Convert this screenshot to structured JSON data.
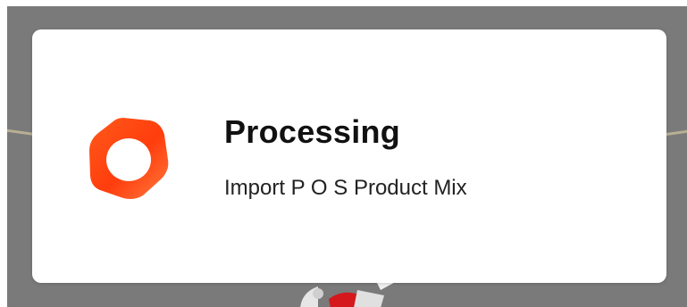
{
  "dialog": {
    "title": "Processing",
    "message": "Import P O S Product Mix",
    "spinner_icon": "loading-ring-icon"
  },
  "colors": {
    "accent": "#ff4a12",
    "backdrop": "#7a7a7a",
    "modal_background": "#ffffff"
  }
}
